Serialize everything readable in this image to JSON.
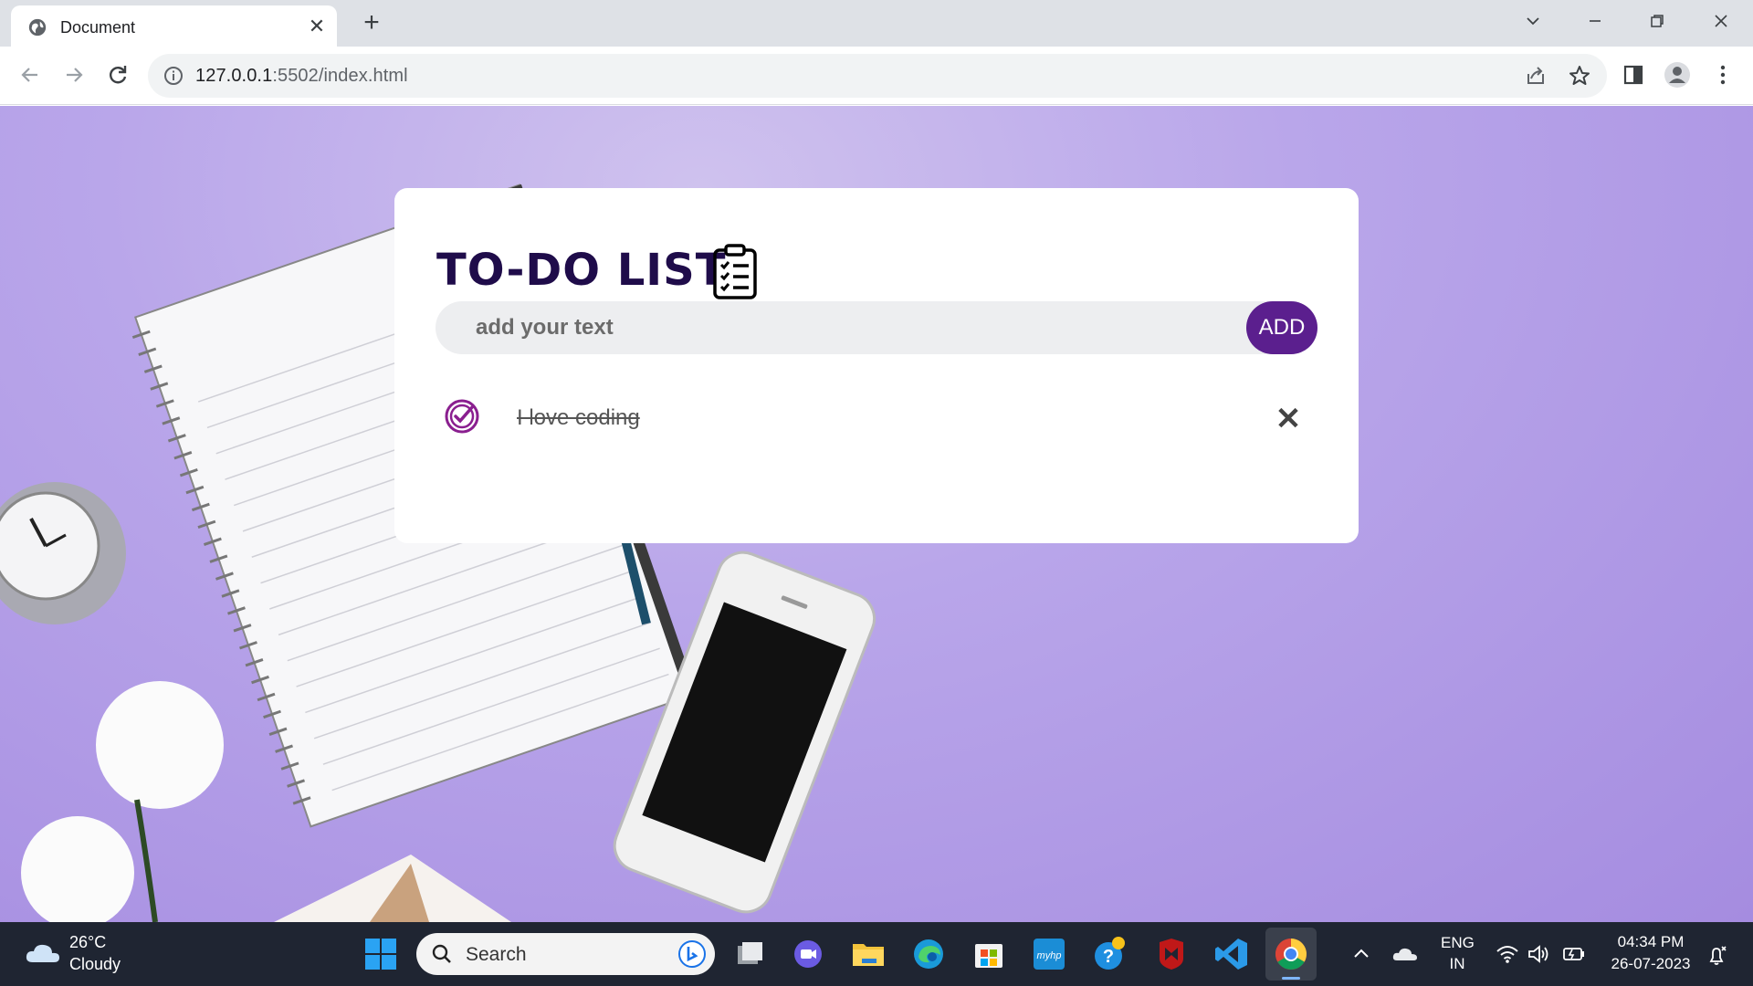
{
  "browser": {
    "tab_title": "Document",
    "url_host": "127.0.0.1",
    "url_path": ":5502/index.html"
  },
  "app": {
    "title": "TO-DO LIST",
    "input_placeholder": "add your text",
    "add_label": "ADD",
    "accent_color": "#5b1f8e",
    "tasks": [
      {
        "text": "I love coding",
        "completed": true
      }
    ],
    "delete_glyph": "✕"
  },
  "taskbar": {
    "weather_temp": "26°C",
    "weather_desc": "Cloudy",
    "search_label": "Search",
    "lang_top": "ENG",
    "lang_bottom": "IN",
    "time": "04:34 PM",
    "date": "26-07-2023"
  }
}
